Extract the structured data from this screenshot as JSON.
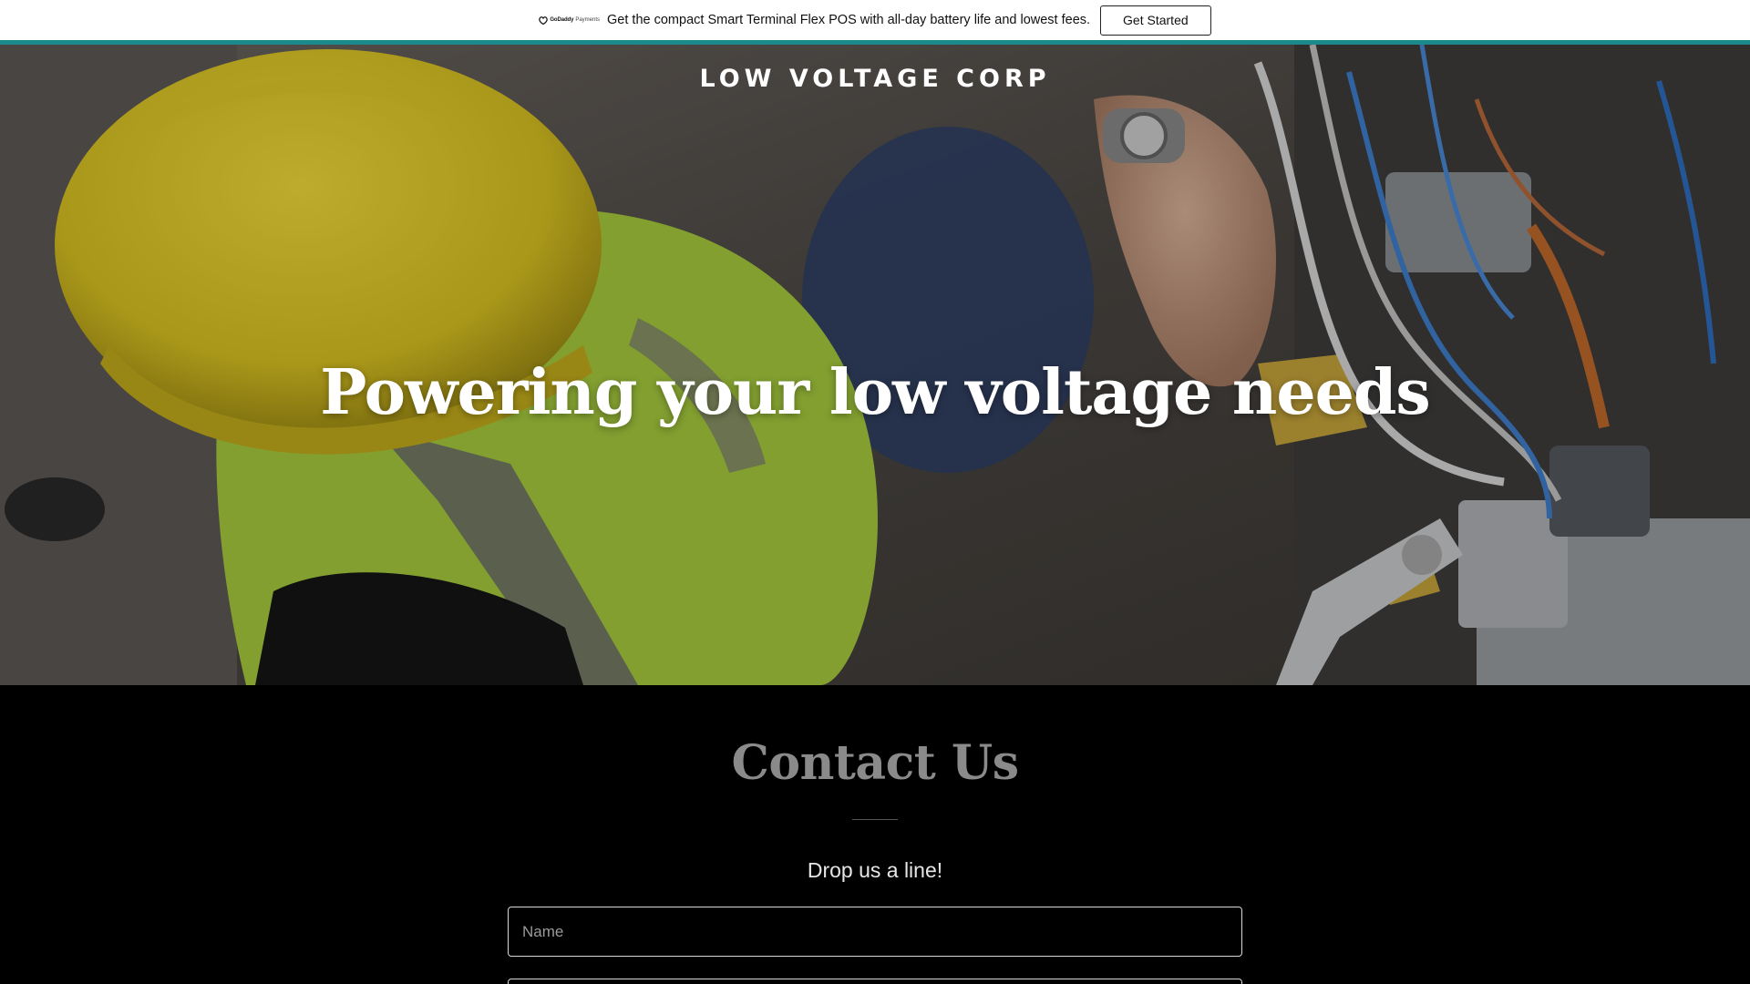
{
  "promo": {
    "logo_brand": "GoDaddy",
    "logo_sub": "Payments",
    "text": "Get the compact Smart Terminal Flex POS with all-day battery life and lowest fees.",
    "button_label": "Get Started"
  },
  "hero": {
    "site_title": "LOW VOLTAGE CORP",
    "tagline": "Powering your low voltage needs"
  },
  "contact": {
    "title": "Contact Us",
    "subtitle": "Drop us a line!",
    "name_placeholder": "Name",
    "email_placeholder": ""
  },
  "colors": {
    "accent_line": "#1a8a8c",
    "hard_hat": "#e6cf2a",
    "vest": "#b6d84a",
    "background": "#000000"
  }
}
